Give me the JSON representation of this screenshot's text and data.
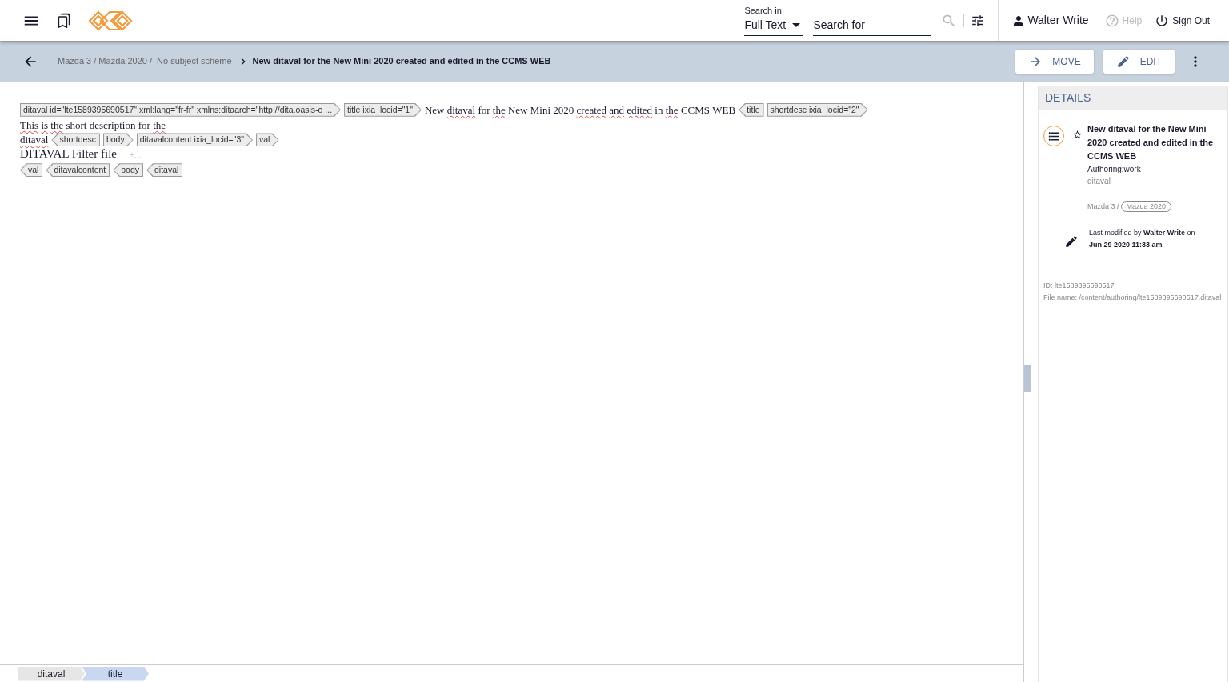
{
  "header": {
    "search_in": {
      "label": "Search in",
      "value": "Full Text"
    },
    "search": {
      "placeholder": "Search for"
    },
    "user": "Walter Write",
    "help": {
      "label": "Help",
      "disabled": true
    },
    "sign_out": "Sign Out"
  },
  "toolbar": {
    "breadcrumb": [
      {
        "text": "Mazda 3 / Mazda 2020 /",
        "kind": "path"
      },
      {
        "text": "No subject scheme",
        "kind": "path"
      },
      {
        "text": "New ditaval for the New Mini 2020 created and edited in the CCMS WEB",
        "kind": "current"
      }
    ],
    "buttons": [
      {
        "label": "MOVE",
        "kind": "move"
      },
      {
        "label": "EDIT",
        "kind": "edit"
      }
    ]
  },
  "editor": {
    "tokens": [
      {
        "kind": "open",
        "text": "ditaval id=\"lte1589395690517\" xml:lang=\"fr-fr\" xmlns:ditaarch=\"http://dita.oasis-o ..."
      },
      {
        "kind": "open",
        "text": "title ixia_locid=\"1\""
      },
      {
        "kind": "text",
        "words": [
          {
            "text": "New",
            "flagged": false
          },
          {
            "text": "ditaval",
            "flagged": true
          },
          {
            "text": "for",
            "flagged": false
          },
          {
            "text": "the",
            "flagged": true
          },
          {
            "text": "New",
            "flagged": false
          },
          {
            "text": "Mini",
            "flagged": false
          },
          {
            "text": "2020",
            "flagged": false
          },
          {
            "text": "created",
            "flagged": true
          },
          {
            "text": "and",
            "flagged": true
          },
          {
            "text": "edited",
            "flagged": true
          },
          {
            "text": "in",
            "flagged": false
          },
          {
            "text": "the",
            "flagged": true
          },
          {
            "text": "CCMS",
            "flagged": false
          },
          {
            "text": "WEB",
            "flagged": false
          }
        ]
      },
      {
        "kind": "close",
        "text": "title"
      },
      {
        "kind": "open",
        "text": "shortdesc ixia_locid=\"2\""
      },
      {
        "kind": "text",
        "words": [
          {
            "text": "This",
            "flagged": true
          },
          {
            "text": "is",
            "flagged": true
          },
          {
            "text": "the",
            "flagged": true
          },
          {
            "text": "short",
            "flagged": false
          },
          {
            "text": "description",
            "flagged": false
          },
          {
            "text": "for",
            "flagged": false
          },
          {
            "text": "the",
            "flagged": true
          }
        ]
      },
      {
        "kind": "break"
      },
      {
        "kind": "text",
        "words": [
          {
            "text": "ditaval",
            "flagged": true
          }
        ]
      },
      {
        "kind": "close",
        "text": "shortdesc"
      },
      {
        "kind": "open",
        "text": "body"
      },
      {
        "kind": "open",
        "text": "ditavalcontent ixia_locid=\"3\""
      },
      {
        "kind": "open",
        "text": "val"
      },
      {
        "kind": "break"
      },
      {
        "kind": "heading",
        "text": "DITAVAL Filter file"
      },
      {
        "kind": "hint",
        "text": "+..."
      },
      {
        "kind": "break"
      },
      {
        "kind": "close",
        "text": "val"
      },
      {
        "kind": "close",
        "text": "ditavalcontent"
      },
      {
        "kind": "close",
        "text": "body"
      },
      {
        "kind": "close",
        "text": "ditaval"
      }
    ],
    "path": [
      {
        "label": "ditaval",
        "selected": false
      },
      {
        "label": "title",
        "selected": true
      }
    ]
  },
  "details": {
    "heading": "DETAILS",
    "title": "New ditaval for the New Mini 2020 created and edited in the CCMS WEB",
    "starred": false,
    "status": "Authoring:work",
    "type": "ditaval",
    "location": "Mazda 3 /",
    "folder": "Mazda 2020",
    "modified_by": "Last modified by **Walter Write** on",
    "modified_at": "Jun 29 2020 11:33 am",
    "id": "ID: lte1589395690517",
    "file_name": "File name: /content/authoring/lte1589395690517.ditaval"
  }
}
